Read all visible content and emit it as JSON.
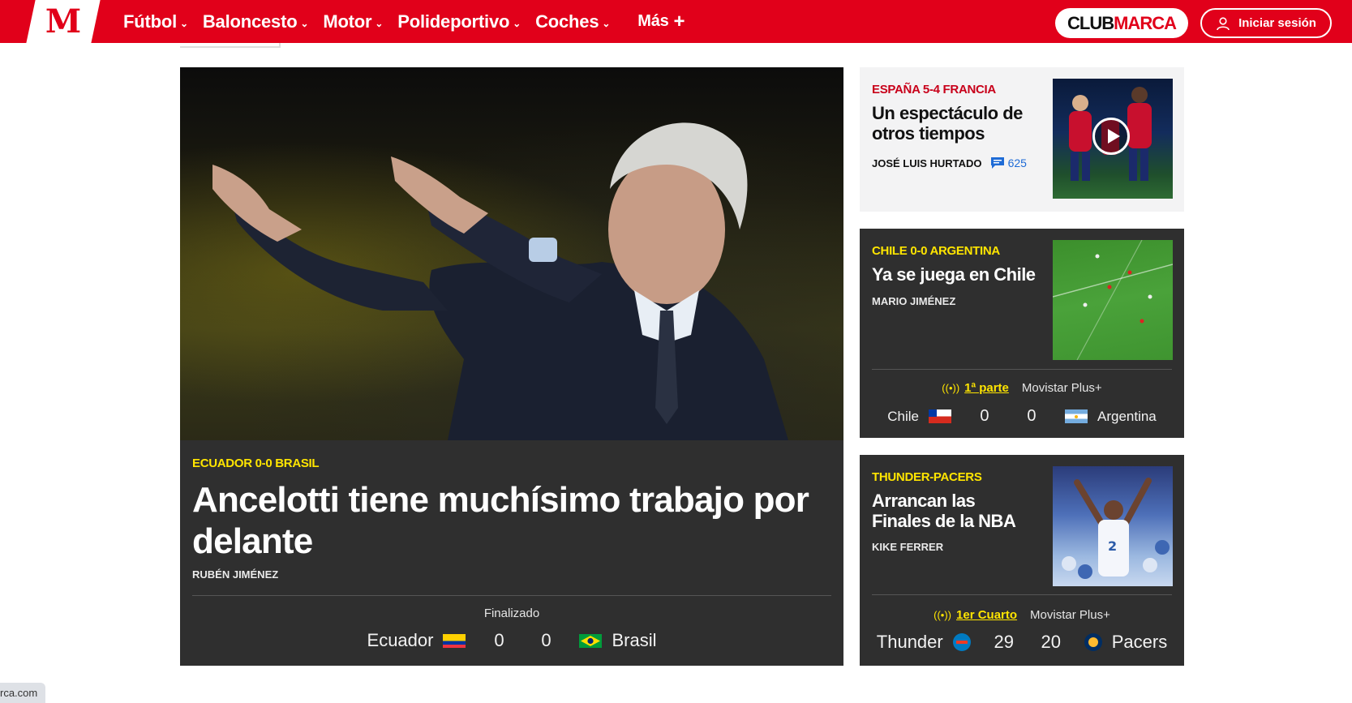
{
  "header": {
    "logo_letter": "M",
    "nav": [
      {
        "label": "Fútbol",
        "has_menu": true
      },
      {
        "label": "Baloncesto",
        "has_menu": true
      },
      {
        "label": "Motor",
        "has_menu": true
      },
      {
        "label": "Polideportivo",
        "has_menu": true
      },
      {
        "label": "Coches",
        "has_menu": true
      }
    ],
    "more_label": "Más",
    "more_icon": "+",
    "club_part1": "CLUB",
    "club_part2": "MARCA",
    "login_label": "Iniciar sesión"
  },
  "lead": {
    "kicker": "ECUADOR 0-0 BRASIL",
    "title": "Ancelotti tiene muchísimo trabajo por delante",
    "author": "RUBÉN JIMÉNEZ",
    "status": "Finalizado",
    "home_team": "Ecuador",
    "home_score": "0",
    "away_score": "0",
    "away_team": "Brasil"
  },
  "cards": [
    {
      "kicker": "ESPAÑA 5-4 FRANCIA",
      "title": "Un espectáculo de otros tiempos",
      "author": "JOSÉ LUIS HURTADO",
      "comments": "625",
      "thumb_icon": "play-icon"
    },
    {
      "kicker": "CHILE 0-0 ARGENTINA",
      "title": "Ya se juega en Chile",
      "author": "MARIO JIMÉNEZ",
      "live_status": "1ª parte",
      "broadcaster": "Movistar Plus+",
      "home_team": "Chile",
      "home_score": "0",
      "away_score": "0",
      "away_team": "Argentina"
    },
    {
      "kicker": "THUNDER-PACERS",
      "title": "Arrancan las Finales de la NBA",
      "author": "KIKE FERRER",
      "live_status": "1er Cuarto",
      "broadcaster": "Movistar Plus+",
      "home_team": "Thunder",
      "home_score": "29",
      "away_score": "20",
      "away_team": "Pacers"
    }
  ],
  "statusbar": {
    "text": "rca.com"
  },
  "colors": {
    "brand_red": "#e1001a",
    "kicker_yellow": "#ffe500",
    "kicker_red": "#c8001a",
    "dark_card": "#2f2f2f",
    "light_card": "#f3f3f4",
    "link_blue": "#1e6bd6"
  }
}
